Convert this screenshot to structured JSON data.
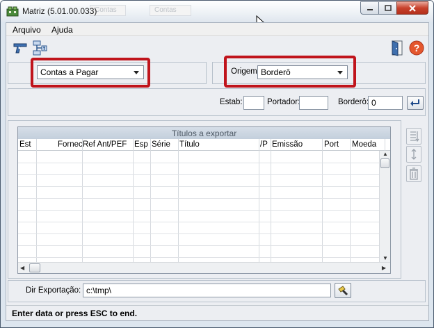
{
  "window": {
    "title": "Matriz (5.01.00.033)",
    "background_tabs": [
      "Contas",
      "Contas"
    ]
  },
  "menu": {
    "items": [
      {
        "label": "Arquivo"
      },
      {
        "label": "Ajuda"
      }
    ]
  },
  "toolbar": {
    "left_icons": [
      "pistol-icon",
      "network-icon"
    ],
    "right_icons": [
      "exit-door-icon",
      "help-icon"
    ]
  },
  "selectors": {
    "tipo": {
      "selected": "Contas a Pagar"
    },
    "origem": {
      "label": "Origem:",
      "selected": "Borderô"
    }
  },
  "filters": {
    "estab": {
      "label": "Estab:",
      "value": ""
    },
    "portador": {
      "label": "Portador:",
      "value": ""
    },
    "bordero": {
      "label": "Borderô:",
      "value": "0"
    }
  },
  "grid": {
    "title": "Títulos a exportar",
    "columns": [
      "Est",
      "Fornec",
      "Ref Ant/PEF",
      "Esp",
      "Série",
      "Título",
      "/P",
      "Emissão",
      "Port",
      "Moeda"
    ],
    "rows": []
  },
  "export": {
    "label": "Dir Exportação:",
    "value": "c:\\tmp\\"
  },
  "status": {
    "text": "Enter data or press ESC to end."
  },
  "colors": {
    "highlight": "#c0141c",
    "client_bg": "#eceef2",
    "grid_header": "#c3cfdc"
  }
}
